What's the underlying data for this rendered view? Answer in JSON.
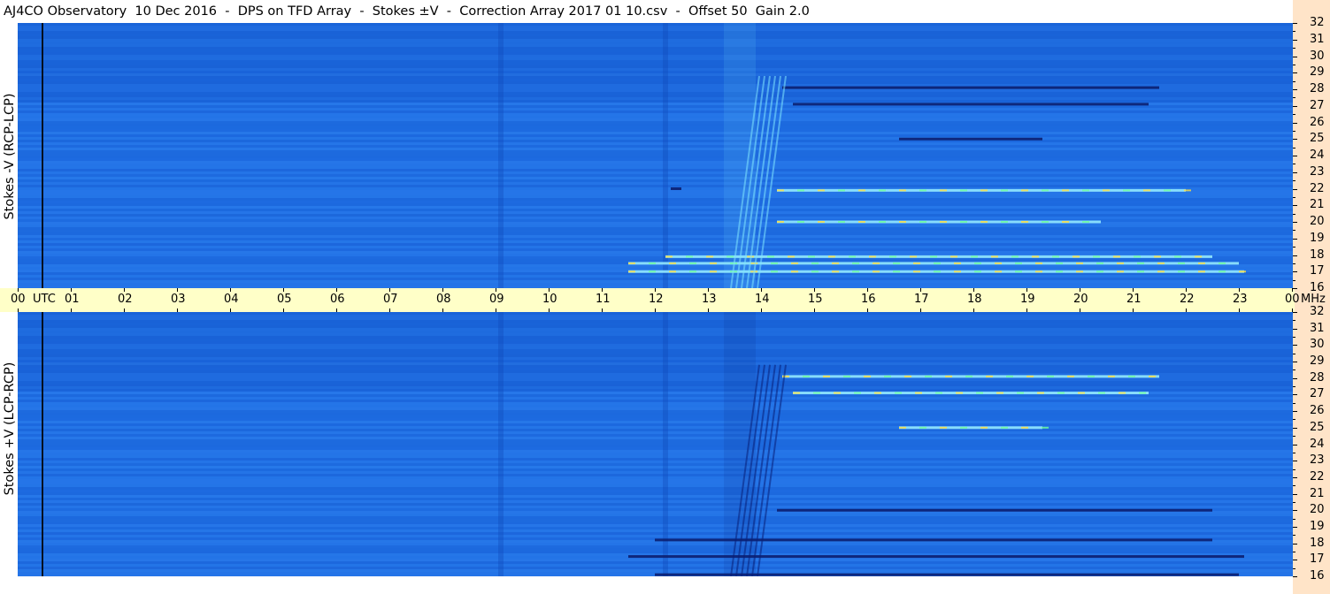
{
  "title": "AJ4CO Observatory  10 Dec 2016  -  DPS on TFD Array  -  Stokes ±V  -  Correction Array 2017 01 10.csv  -  Offset 50  Gain 2.0",
  "colors": {
    "background_field": "#1e6ee6",
    "time_bar": "#ffffc8",
    "right_strip": "#ffe4c8"
  },
  "chart_data": [
    {
      "type": "heatmap",
      "ylabel": "Stokes -V (RCP-LCP)",
      "x_ticks": [
        "00",
        "01",
        "02",
        "03",
        "04",
        "05",
        "06",
        "07",
        "08",
        "09",
        "10",
        "11",
        "12",
        "13",
        "14",
        "15",
        "16",
        "17",
        "18",
        "19",
        "20",
        "21",
        "22",
        "23",
        "00"
      ],
      "x_unit": "UTC",
      "y_ticks": [
        "16",
        "17",
        "18",
        "19",
        "20",
        "21",
        "22",
        "23",
        "24",
        "25",
        "26",
        "27",
        "28",
        "29",
        "30",
        "31",
        "32"
      ],
      "y_unit": "MHz",
      "ylim": [
        16,
        32
      ],
      "xlim_hours": [
        0,
        24
      ],
      "features": [
        {
          "kind": "dark_band",
          "freq": 28.1,
          "start": 14.4,
          "end": 21.5
        },
        {
          "kind": "dark_band",
          "freq": 27.1,
          "start": 14.6,
          "end": 21.3
        },
        {
          "kind": "dark_band",
          "freq": 25.0,
          "start": 16.6,
          "end": 19.3
        },
        {
          "kind": "dark_band",
          "freq": 22.0,
          "start": 12.3,
          "end": 12.5
        },
        {
          "kind": "bright_band",
          "freq": 21.9,
          "start": 14.3,
          "end": 22.0
        },
        {
          "kind": "bright_band",
          "freq": 20.0,
          "start": 14.3,
          "end": 20.4
        },
        {
          "kind": "bright_band",
          "freq": 17.9,
          "start": 12.2,
          "end": 22.5
        },
        {
          "kind": "bright_band",
          "freq": 17.5,
          "start": 11.5,
          "end": 23.0
        },
        {
          "kind": "bright_band",
          "freq": 17.0,
          "start": 11.5,
          "end": 23.1
        },
        {
          "kind": "burst",
          "start": 13.3,
          "end": 13.9
        }
      ]
    },
    {
      "type": "heatmap",
      "ylabel": "Stokes +V (LCP-RCP)",
      "x_ticks": [
        "00",
        "01",
        "02",
        "03",
        "04",
        "05",
        "06",
        "07",
        "08",
        "09",
        "10",
        "11",
        "12",
        "13",
        "14",
        "15",
        "16",
        "17",
        "18",
        "19",
        "20",
        "21",
        "22",
        "23",
        "00"
      ],
      "x_unit": "UTC",
      "y_ticks": [
        "16",
        "17",
        "18",
        "19",
        "20",
        "21",
        "22",
        "23",
        "24",
        "25",
        "26",
        "27",
        "28",
        "29",
        "30",
        "31",
        "32"
      ],
      "y_unit": "MHz",
      "ylim": [
        16,
        32
      ],
      "xlim_hours": [
        0,
        24
      ],
      "features": [
        {
          "kind": "bright_band",
          "freq": 28.1,
          "start": 14.4,
          "end": 21.5
        },
        {
          "kind": "bright_band",
          "freq": 27.1,
          "start": 14.6,
          "end": 21.3
        },
        {
          "kind": "bright_band",
          "freq": 25.0,
          "start": 16.6,
          "end": 19.3
        },
        {
          "kind": "dark_band",
          "freq": 20.0,
          "start": 14.3,
          "end": 22.5
        },
        {
          "kind": "dark_band",
          "freq": 18.2,
          "start": 12.0,
          "end": 22.5
        },
        {
          "kind": "dark_band",
          "freq": 17.2,
          "start": 11.5,
          "end": 23.1
        },
        {
          "kind": "dark_band",
          "freq": 16.1,
          "start": 12.0,
          "end": 23.0
        },
        {
          "kind": "dark_burst",
          "start": 13.3,
          "end": 13.9
        }
      ]
    }
  ]
}
